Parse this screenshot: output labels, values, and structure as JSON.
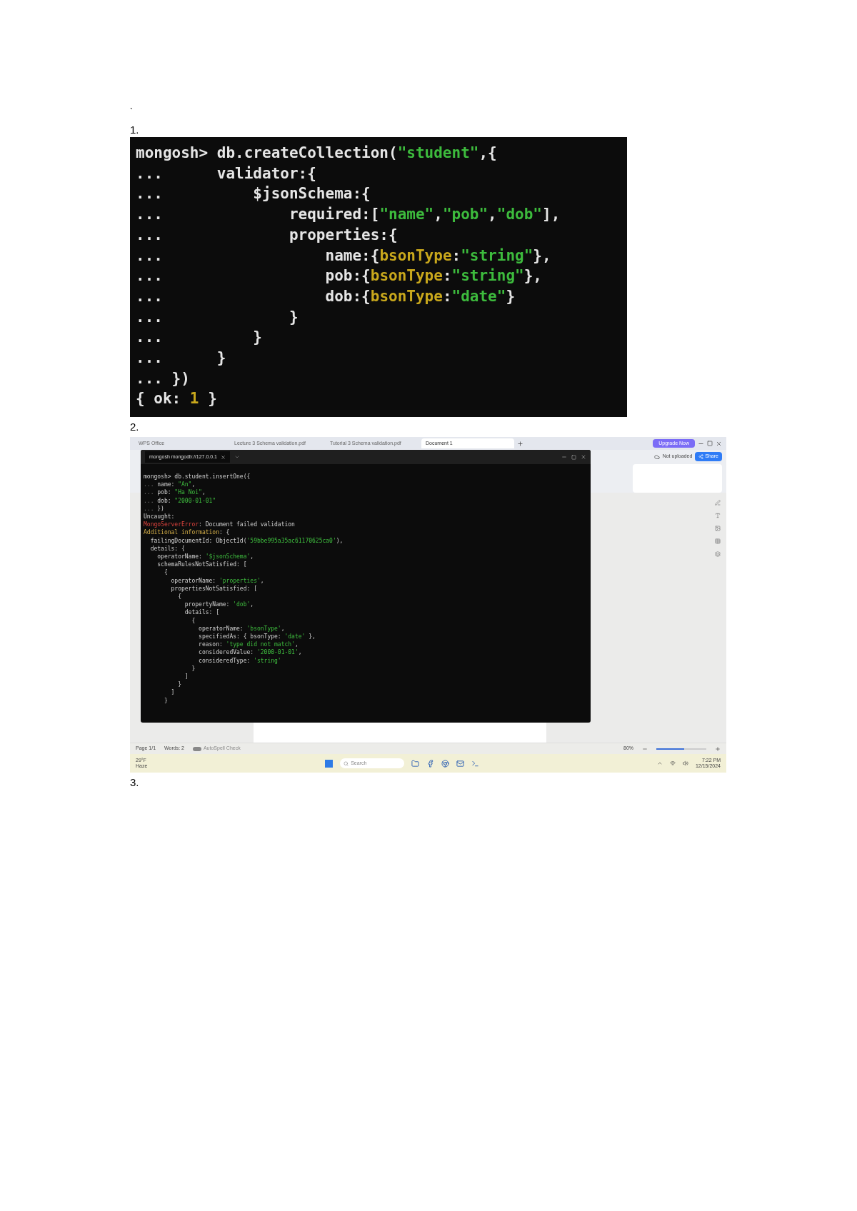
{
  "page_mark": "`",
  "sections": [
    {
      "number": "1."
    },
    {
      "number": "2."
    },
    {
      "number": "3."
    }
  ],
  "shell_capture": {
    "lines": [
      [
        {
          "kind": "plain",
          "text": "mongosh> db.createCollection("
        },
        {
          "kind": "string",
          "text": "\"student\""
        },
        {
          "kind": "plain",
          "text": ",{"
        }
      ],
      [
        {
          "kind": "plain",
          "text": "...      validator:{"
        }
      ],
      [
        {
          "kind": "plain",
          "text": "...          $jsonSchema:{"
        }
      ],
      [
        {
          "kind": "plain",
          "text": "...              required:["
        },
        {
          "kind": "string",
          "text": "\"name\""
        },
        {
          "kind": "plain",
          "text": ","
        },
        {
          "kind": "string",
          "text": "\"pob\""
        },
        {
          "kind": "plain",
          "text": ","
        },
        {
          "kind": "string",
          "text": "\"dob\""
        },
        {
          "kind": "plain",
          "text": "],"
        }
      ],
      [
        {
          "kind": "plain",
          "text": "...              properties:{"
        }
      ],
      [
        {
          "kind": "plain",
          "text": "...                  name:{"
        },
        {
          "kind": "key",
          "text": "bsonType"
        },
        {
          "kind": "plain",
          "text": ":"
        },
        {
          "kind": "string",
          "text": "\"string\""
        },
        {
          "kind": "plain",
          "text": "},"
        }
      ],
      [
        {
          "kind": "plain",
          "text": "...                  pob:{"
        },
        {
          "kind": "key",
          "text": "bsonType"
        },
        {
          "kind": "plain",
          "text": ":"
        },
        {
          "kind": "string",
          "text": "\"string\""
        },
        {
          "kind": "plain",
          "text": "},"
        }
      ],
      [
        {
          "kind": "plain",
          "text": "...                  dob:{"
        },
        {
          "kind": "key",
          "text": "bsonType"
        },
        {
          "kind": "plain",
          "text": ":"
        },
        {
          "kind": "string",
          "text": "\"date\""
        },
        {
          "kind": "plain",
          "text": "}"
        }
      ],
      [
        {
          "kind": "plain",
          "text": "...              }"
        }
      ],
      [
        {
          "kind": "plain",
          "text": "...          }"
        }
      ],
      [
        {
          "kind": "plain",
          "text": "...      }"
        }
      ],
      [
        {
          "kind": "plain",
          "text": "... })"
        }
      ],
      [
        {
          "kind": "plain",
          "text": "{ ok: "
        },
        {
          "kind": "key",
          "text": "1"
        },
        {
          "kind": "plain",
          "text": " }"
        }
      ]
    ]
  },
  "desktop_capture": {
    "browser_tabs": [
      {
        "label": "WPS Office",
        "selected": false
      },
      {
        "label": "Lecture 3 Schema validation.pdf",
        "selected": false
      },
      {
        "label": "Tutorial 3 Schema validation.pdf",
        "selected": false
      },
      {
        "label": "Document 1",
        "selected": true
      }
    ],
    "upgrade_button": "Upgrade Now",
    "upload_status": "Not uploaded",
    "share_button": "Share",
    "terminal": {
      "tab_title": "mongosh mongodb://127.0.0.1",
      "lines": [
        [
          {
            "kind": "plain",
            "text": "mongosh> db.student.insertOne({"
          }
        ],
        [
          {
            "kind": "dim",
            "text": "... "
          },
          {
            "kind": "plain",
            "text": "name: "
          },
          {
            "kind": "string",
            "text": "\"An\""
          },
          {
            "kind": "plain",
            "text": ","
          }
        ],
        [
          {
            "kind": "dim",
            "text": "... "
          },
          {
            "kind": "plain",
            "text": "pob: "
          },
          {
            "kind": "string",
            "text": "\"Ha Noi\""
          },
          {
            "kind": "plain",
            "text": ","
          }
        ],
        [
          {
            "kind": "dim",
            "text": "... "
          },
          {
            "kind": "plain",
            "text": "dob: "
          },
          {
            "kind": "string",
            "text": "\"2000-01-01\""
          }
        ],
        [
          {
            "kind": "dim",
            "text": "... "
          },
          {
            "kind": "plain",
            "text": "})"
          }
        ],
        [
          {
            "kind": "plain",
            "text": "Uncaught:"
          }
        ],
        [
          {
            "kind": "error",
            "text": "MongoServerError"
          },
          {
            "kind": "plain",
            "text": ": Document failed validation"
          }
        ],
        [
          {
            "kind": "warn",
            "text": "Additional information"
          },
          {
            "kind": "plain",
            "text": ": {"
          }
        ],
        [
          {
            "kind": "plain",
            "text": "  failingDocumentId: ObjectId("
          },
          {
            "kind": "string",
            "text": "'59bbe995a35ac61170625ca0'"
          },
          {
            "kind": "plain",
            "text": "),"
          }
        ],
        [
          {
            "kind": "plain",
            "text": "  details: {"
          }
        ],
        [
          {
            "kind": "plain",
            "text": "    operatorName: "
          },
          {
            "kind": "string",
            "text": "'$jsonSchema'"
          },
          {
            "kind": "plain",
            "text": ","
          }
        ],
        [
          {
            "kind": "plain",
            "text": "    schemaRulesNotSatisfied: ["
          }
        ],
        [
          {
            "kind": "plain",
            "text": "      {"
          }
        ],
        [
          {
            "kind": "plain",
            "text": "        operatorName: "
          },
          {
            "kind": "string",
            "text": "'properties'"
          },
          {
            "kind": "plain",
            "text": ","
          }
        ],
        [
          {
            "kind": "plain",
            "text": "        propertiesNotSatisfied: ["
          }
        ],
        [
          {
            "kind": "plain",
            "text": "          {"
          }
        ],
        [
          {
            "kind": "plain",
            "text": "            propertyName: "
          },
          {
            "kind": "string",
            "text": "'dob'"
          },
          {
            "kind": "plain",
            "text": ","
          }
        ],
        [
          {
            "kind": "plain",
            "text": "            details: ["
          }
        ],
        [
          {
            "kind": "plain",
            "text": "              {"
          }
        ],
        [
          {
            "kind": "plain",
            "text": "                operatorName: "
          },
          {
            "kind": "string",
            "text": "'bsonType'"
          },
          {
            "kind": "plain",
            "text": ","
          }
        ],
        [
          {
            "kind": "plain",
            "text": "                specifiedAs: { bsonType: "
          },
          {
            "kind": "string",
            "text": "'date'"
          },
          {
            "kind": "plain",
            "text": " },"
          }
        ],
        [
          {
            "kind": "plain",
            "text": "                reason: "
          },
          {
            "kind": "string",
            "text": "'type did not match'"
          },
          {
            "kind": "plain",
            "text": ","
          }
        ],
        [
          {
            "kind": "plain",
            "text": "                consideredValue: "
          },
          {
            "kind": "string",
            "text": "'2000-01-01'"
          },
          {
            "kind": "plain",
            "text": ","
          }
        ],
        [
          {
            "kind": "plain",
            "text": "                consideredType: "
          },
          {
            "kind": "string",
            "text": "'string'"
          }
        ],
        [
          {
            "kind": "plain",
            "text": "              }"
          }
        ],
        [
          {
            "kind": "plain",
            "text": "            ]"
          }
        ],
        [
          {
            "kind": "plain",
            "text": "          }"
          }
        ],
        [
          {
            "kind": "plain",
            "text": "        ]"
          }
        ],
        [
          {
            "kind": "plain",
            "text": "      }"
          }
        ]
      ]
    },
    "status_bar": {
      "page": "Page 1/1",
      "words": "Words: 2",
      "spell_check": {
        "label": "AutoSpell Check",
        "on": false
      },
      "zoom": "80%",
      "zoom_slider": {
        "level": 0.55
      }
    },
    "taskbar": {
      "weather_temp": "29°F",
      "weather_desc": "Haze",
      "search_placeholder": "Search",
      "time": "7:22 PM",
      "date": "12/15/2024"
    }
  }
}
